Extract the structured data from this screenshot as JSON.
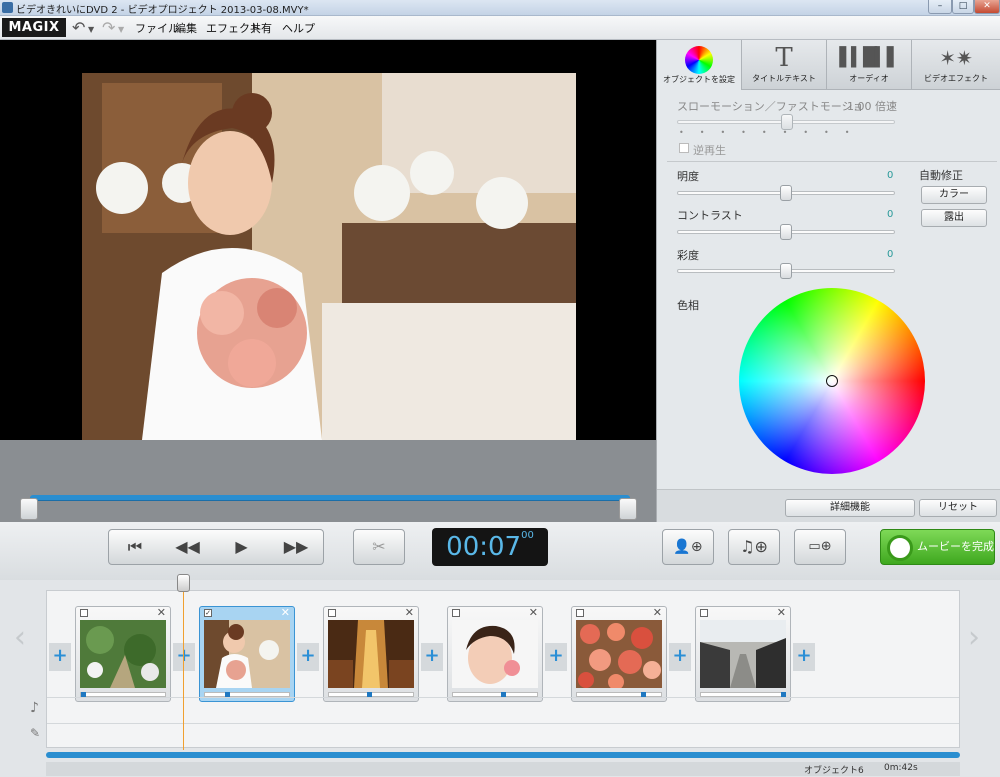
{
  "window": {
    "title": "ビデオきれいにDVD 2 - ビデオプロジェクト 2013-03-08.MVY*",
    "controls": [
      "–",
      "□",
      "✕"
    ]
  },
  "app": {
    "logo": "MAGIX"
  },
  "menu": [
    "ファイル",
    "編集",
    "エフェクト",
    "共有",
    "ヘルプ"
  ],
  "tabs": [
    {
      "label": "オブジェクトを設定",
      "icon": "color-wheel-icon",
      "active": true
    },
    {
      "label": "タイトルテキスト",
      "icon": "title-text-icon"
    },
    {
      "label": "オーディオ",
      "icon": "audio-waveform-icon"
    },
    {
      "label": "ビデオエフェクト",
      "icon": "video-effects-icon"
    }
  ],
  "settings": {
    "speed_label": "スローモーション／ファストモーショ",
    "speed_value": "1.00 倍速",
    "reverse_label": "逆再生",
    "brightness_label": "明度",
    "brightness_value": "0",
    "contrast_label": "コントラスト",
    "contrast_value": "0",
    "saturation_label": "彩度",
    "saturation_value": "0",
    "hue_label": "色相",
    "auto_correct_label": "自動修正",
    "color_button": "カラー",
    "exposure_button": "露出",
    "advanced_button": "詳細機能",
    "reset_button": "リセット"
  },
  "transport": {
    "timecode": "00:07",
    "timecode_frames": "00",
    "finish_button": "ムービーを完成"
  },
  "storyboard": {
    "clips": [
      {
        "name": "garden-path",
        "selected": false
      },
      {
        "name": "bride",
        "selected": true
      },
      {
        "name": "church-aisle",
        "selected": false
      },
      {
        "name": "woman-portrait",
        "selected": false
      },
      {
        "name": "roses",
        "selected": false
      },
      {
        "name": "street",
        "selected": false
      }
    ]
  },
  "status": {
    "objects": "オブジェクト6",
    "duration": "0m:42s"
  }
}
